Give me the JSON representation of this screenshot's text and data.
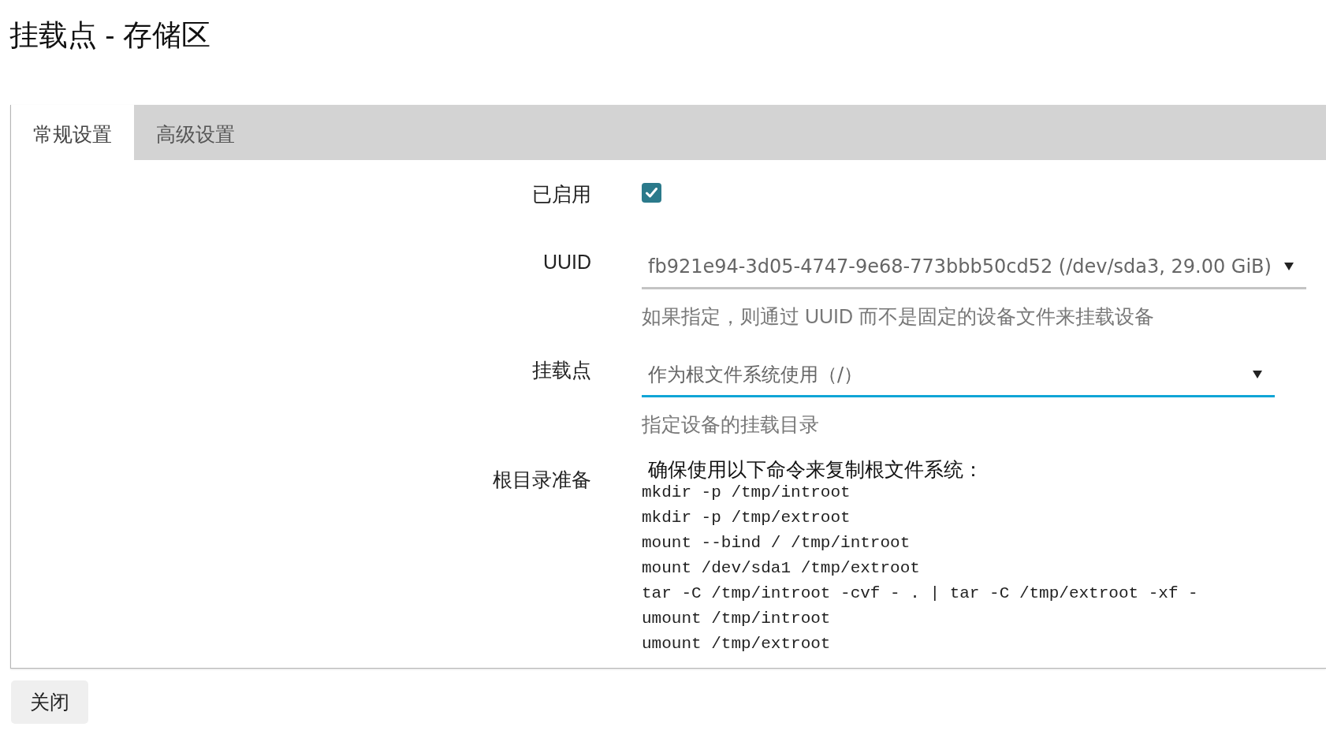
{
  "page_title": "挂载点 - 存储区",
  "tabs": [
    {
      "label": "常规设置",
      "selected": true
    },
    {
      "label": "高级设置",
      "selected": false
    }
  ],
  "fields": [
    {
      "kind": "checkbox",
      "label": "已启用",
      "checked": true
    },
    {
      "kind": "select",
      "label": "UUID",
      "value": "fb921e94-3d05-4747-9e68-773bbb50cd52 (/dev/sda3, 29.00 GiB)",
      "focused": false,
      "help": "如果指定，则通过 UUID 而不是固定的设备文件来挂载设备"
    },
    {
      "kind": "select",
      "label": "挂载点",
      "value": "作为根文件系统使用（/）",
      "focused": true,
      "help": "指定设备的挂载目录"
    },
    {
      "kind": "text_block",
      "label": "根目录准备",
      "intro": "确保使用以下命令来复制根文件系统：",
      "lines": [
        "mkdir -p /tmp/introot",
        "mkdir -p /tmp/extroot",
        "mount --bind / /tmp/introot",
        "mount /dev/sda1 /tmp/extroot",
        "tar -C /tmp/introot -cvf - . | tar -C /tmp/extroot -xf -",
        "umount /tmp/introot",
        "umount /tmp/extroot"
      ]
    }
  ],
  "buttons": [
    {
      "label": "关闭"
    }
  ]
}
